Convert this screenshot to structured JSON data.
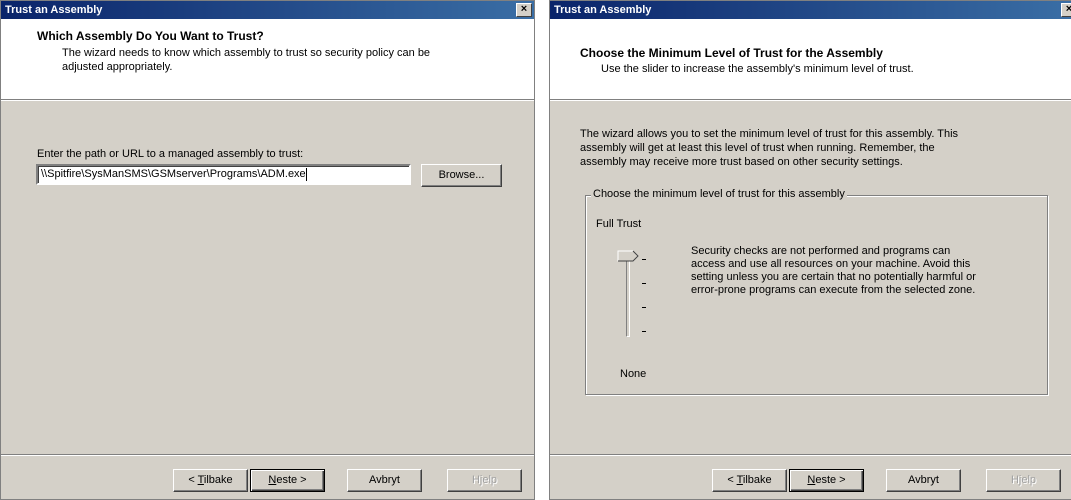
{
  "left_window": {
    "title": "Trust an Assembly",
    "close_glyph": "×",
    "header_title": "Which Assembly Do You Want to Trust?",
    "header_subtitle_line1": "The wizard needs to know which assembly to trust so security policy can be",
    "header_subtitle_line2": "adjusted appropriately.",
    "path_label": "Enter the path or URL to a managed assembly to trust:",
    "path_value": "\\\\Spitfire\\SysManSMS\\GSMserver\\Programs\\ADM.exe",
    "browse_label": "Browse...",
    "buttons": {
      "back_prefix": "< ",
      "back_mnemonic": "T",
      "back_rest": "ilbake",
      "next_mnemonic": "N",
      "next_rest": "este >",
      "cancel": "Avbryt",
      "help": "Hjelp"
    }
  },
  "right_window": {
    "title": "Trust an Assembly",
    "close_glyph": "×",
    "header_title": "Choose the Minimum Level of Trust for the Assembly",
    "header_subtitle": "Use the slider to increase the assembly's minimum level of trust.",
    "intro_line1": "The wizard allows you to set the minimum level of trust for this assembly.  This",
    "intro_line2": "assembly will get at least this level of trust when running.  Remember, the",
    "intro_line3": "assembly may receive more trust based on other security settings.",
    "group_label": "Choose the minimum level of trust for this assembly",
    "slider_top_label": "Full Trust",
    "slider_bottom_label": "None",
    "slider_level": "Full Trust",
    "description_line1": "Security checks are not performed and programs can",
    "description_line2": "access and use all resources on your machine.  Avoid this",
    "description_line3": "setting unless you are certain that no potentially harmful or",
    "description_line4": "error-prone programs can execute from the selected zone.",
    "buttons": {
      "back_prefix": "< ",
      "back_mnemonic": "T",
      "back_rest": "ilbake",
      "next_mnemonic": "N",
      "next_rest": "este >",
      "cancel": "Avbryt",
      "help": "Hjelp"
    }
  }
}
